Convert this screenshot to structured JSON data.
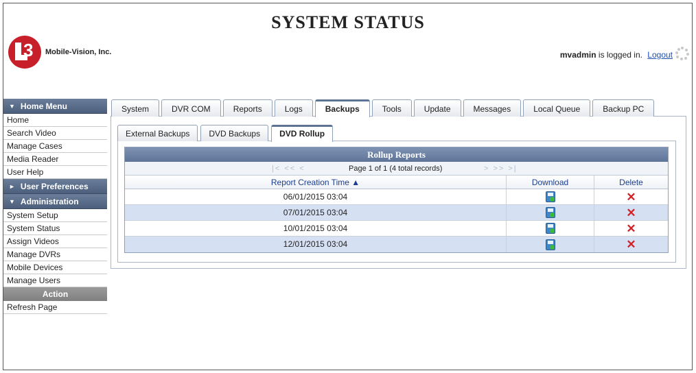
{
  "header": {
    "title": "SYSTEM STATUS",
    "company": "Mobile-Vision, Inc.",
    "logo_mark": "3",
    "user": "mvadmin",
    "logged_in_text": "is logged in.",
    "logout_label": "Logout"
  },
  "sidebar": {
    "home_menu_label": "Home Menu",
    "home_items": [
      "Home",
      "Search Video",
      "Manage Cases",
      "Media Reader",
      "User Help"
    ],
    "user_prefs_label": "User Preferences",
    "admin_label": "Administration",
    "admin_items": [
      "System Setup",
      "System Status",
      "Assign Videos",
      "Manage DVRs",
      "Mobile Devices",
      "Manage Users"
    ],
    "action_label": "Action",
    "action_items": [
      "Refresh Page"
    ]
  },
  "tabs": [
    "System",
    "DVR COM",
    "Reports",
    "Logs",
    "Backups",
    "Tools",
    "Update",
    "Messages",
    "Local Queue",
    "Backup PC"
  ],
  "active_tab": "Backups",
  "subtabs": [
    "External Backups",
    "DVD Backups",
    "DVD Rollup"
  ],
  "active_subtab": "DVD Rollup",
  "grid": {
    "title": "Rollup Reports",
    "page_info": "Page 1 of 1 (4 total records)",
    "columns": [
      "Report Creation Time ▲",
      "Download",
      "Delete"
    ],
    "rows": [
      "06/01/2015 03:04",
      "07/01/2015 03:04",
      "10/01/2015 03:04",
      "12/01/2015 03:04"
    ]
  },
  "icons": {
    "download": "floppy-download-icon",
    "delete": "red-x-icon",
    "spinner": "loading-spinner-icon"
  },
  "colors": {
    "brand_red": "#c8202a",
    "header_blue": "#5e7498",
    "link_blue": "#1a4fb5",
    "delete_red": "#d0242a",
    "alt_row": "#d6e0f3"
  }
}
